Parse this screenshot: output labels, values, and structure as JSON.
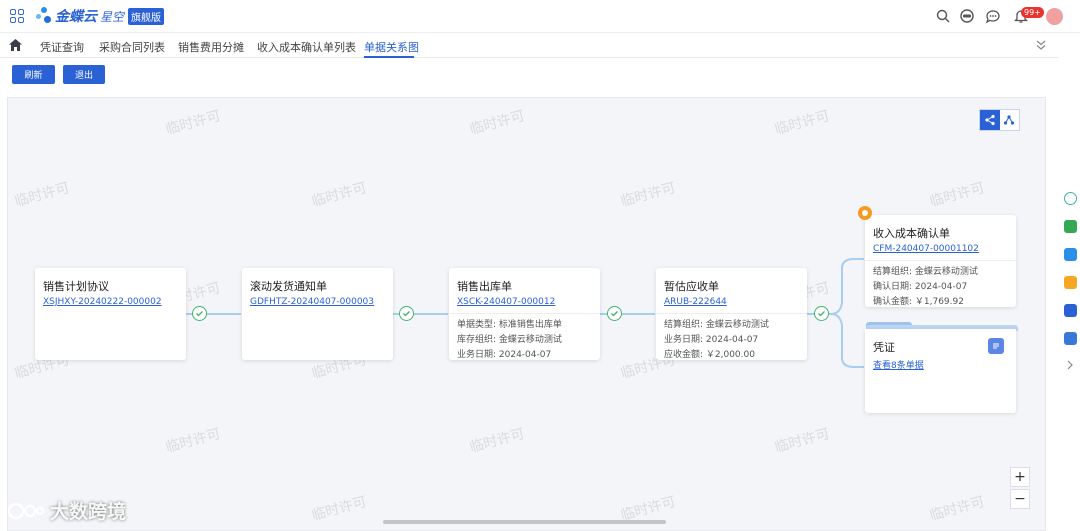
{
  "app": {
    "logo_text": "金蝶云",
    "logo_sub": "星空",
    "logo_badge": "旗舰版",
    "notification_count": "99+"
  },
  "tabs": [
    {
      "label": "凭证查询"
    },
    {
      "label": "采购合同列表"
    },
    {
      "label": "销售费用分摊"
    },
    {
      "label": "收入成本确认单列表"
    },
    {
      "label": "单据关系图",
      "active": true
    }
  ],
  "toolbar": {
    "refresh_label": "刷新",
    "exit_label": "退出"
  },
  "watermark": "临时许可",
  "nodes": {
    "plan": {
      "title": "销售计划协议",
      "code": "XSJHXY-20240222-000002"
    },
    "notice": {
      "title": "滚动发货通知单",
      "code": "GDFHTZ-20240407-000003"
    },
    "outbound": {
      "title": "销售出库单",
      "code": "XSCK-240407-000012",
      "rows": [
        "单据类型: 标准销售出库单",
        "库存组织: 金蝶云移动测试",
        "业务日期: 2024-04-07"
      ]
    },
    "receivable": {
      "title": "暂估应收单",
      "code": "ARUB-222644",
      "rows": [
        "结算组织: 金蝶云移动测试",
        "业务日期: 2024-04-07",
        "应收金额: ￥2,000.00"
      ]
    },
    "confirm": {
      "title": "收入成本确认单",
      "code": "CFM-240407-00001102",
      "rows": [
        "结算组织: 金蝶云移动测试",
        "确认日期: 2024-04-07",
        "确认金额: ￥1,769.92"
      ]
    },
    "voucher": {
      "title": "凭证",
      "link": "查看8条单据"
    }
  },
  "zoom": {
    "in": "+",
    "out": "−"
  },
  "brand_text": "大数跨境",
  "colors": {
    "accent": "#2a62d6",
    "success": "#44b36a",
    "connector": "#a8cdf2",
    "pin": "#f59a23"
  }
}
